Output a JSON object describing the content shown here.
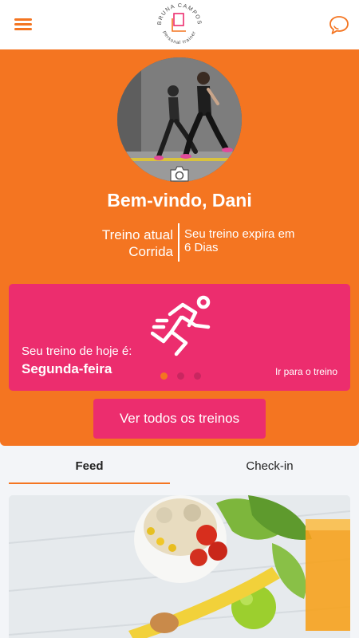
{
  "header": {
    "menu_icon": "hamburger-menu-icon",
    "logo_text_top": "BRUNA CAMPOS",
    "logo_text_bottom": "personal trainer",
    "chat_icon": "chat-bubble-icon",
    "accent_color": "#f47521"
  },
  "profile": {
    "welcome": "Bem-vindo, Dani",
    "current_plan_label": "Treino atual",
    "current_plan_value": "Corrida",
    "expiry_line1": "Seu treino expira em",
    "expiry_line2": "6 Dias",
    "camera_icon": "camera-icon"
  },
  "workout_card": {
    "today_label": "Seu treino de hoje é:",
    "today_day": "Segunda-feira",
    "go_link": "Ir para o treino",
    "icon": "runner-icon",
    "card_color": "#ec2d6e",
    "slide_count": 3,
    "active_slide": 1
  },
  "actions": {
    "all_workouts": "Ver todos os treinos"
  },
  "tabs": [
    {
      "label": "Feed",
      "active": true
    },
    {
      "label": "Check-in",
      "active": false
    }
  ],
  "feed": {
    "items": [
      {
        "image": "healthy-food-salad-photo"
      }
    ]
  }
}
